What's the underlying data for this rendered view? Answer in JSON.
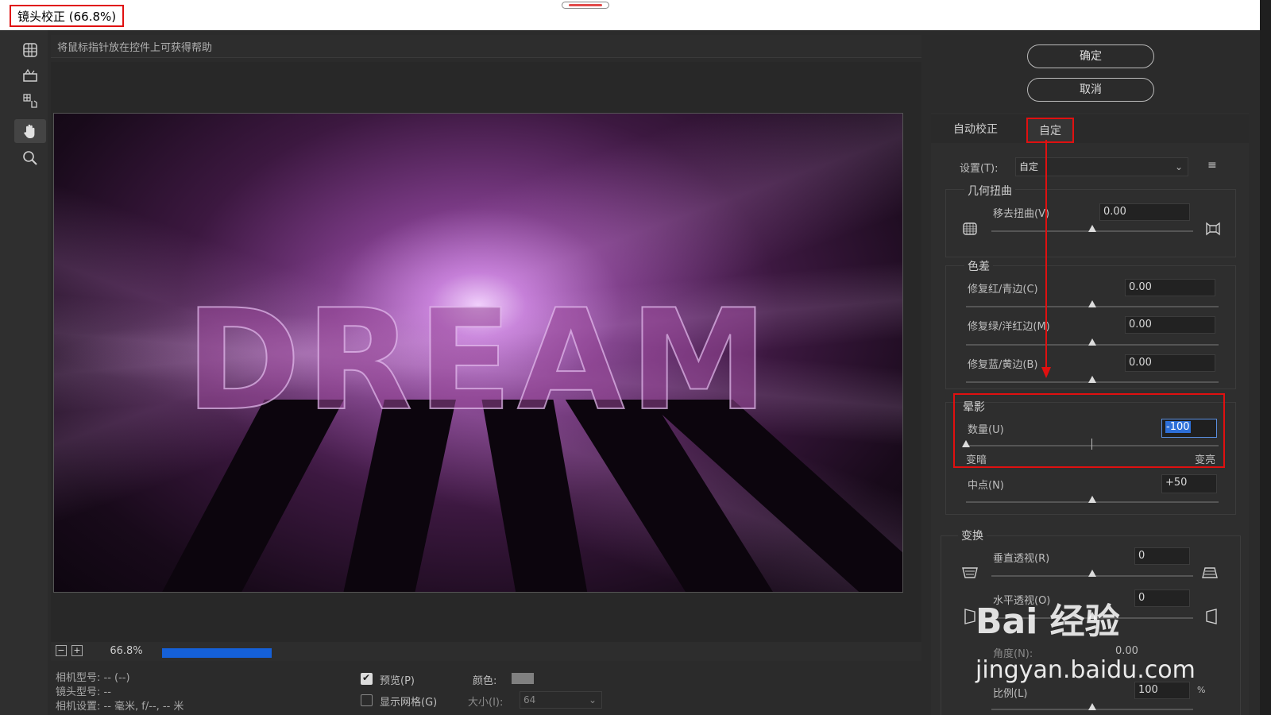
{
  "window": {
    "title": "镜头校正 (66.8%)"
  },
  "help": {
    "text": "将鼠标指针放在控件上可获得帮助"
  },
  "tools": [
    "remove-distortion-tool",
    "straighten-tool",
    "move-grid-tool",
    "hand-tool",
    "zoom-tool"
  ],
  "preview": {
    "text": "DREAM"
  },
  "zoom": {
    "minus": "−",
    "plus": "+",
    "value": "66.8%",
    "dropdown": "⌄",
    "progress": 1.0
  },
  "camera": {
    "model": "相机型号: -- (--)",
    "lens": "镜头型号: --",
    "settings": "相机设置: -- 毫米, f/--, -- 米"
  },
  "options": {
    "preview_label": "预览(P)",
    "preview_checked": true,
    "grid_label": "显示网格(G)",
    "grid_checked": false,
    "color_label": "颜色:",
    "color_value": "#808080",
    "size_label": "大小(I):",
    "size_value": "64"
  },
  "buttons": {
    "ok": "确定",
    "cancel": "取消"
  },
  "tabs": {
    "auto": "自动校正",
    "custom": "自定"
  },
  "settings": {
    "label": "设置(T):",
    "value": "自定",
    "menu_icon": "≡"
  },
  "geometry": {
    "title": "几何扭曲",
    "remove_label": "移去扭曲(V)",
    "remove_value": "0.00",
    "remove_level": 0.5
  },
  "chromatic": {
    "title": "色差",
    "red_label": "修复红/青边(C)",
    "red_value": "0.00",
    "green_label": "修复绿/洋红边(M)",
    "green_value": "0.00",
    "blue_label": "修复蓝/黄边(B)",
    "blue_value": "0.00"
  },
  "vignette": {
    "title": "晕影",
    "amount_label": "数量(U)",
    "amount_value": "-100",
    "amount_level": 0.0,
    "darken": "变暗",
    "lighten": "变亮",
    "midpoint_label": "中点(N)",
    "midpoint_value": "+50",
    "midpoint_level": 0.5
  },
  "transform": {
    "title": "变换",
    "vertical_label": "垂直透视(R)",
    "vertical_value": "0",
    "horizontal_label": "水平透视(O)",
    "horizontal_value": "0",
    "angle_label": "角度(N):",
    "angle_value": "0.00",
    "scale_label": "比例(L)",
    "scale_value": "100",
    "scale_unit": "%"
  },
  "watermark": {
    "brand": "Bai 经验",
    "url": "jingyan.baidu.com"
  },
  "colors": {
    "accent": "#e01010",
    "progress": "#1560d8",
    "panel": "#2e2e2e"
  }
}
